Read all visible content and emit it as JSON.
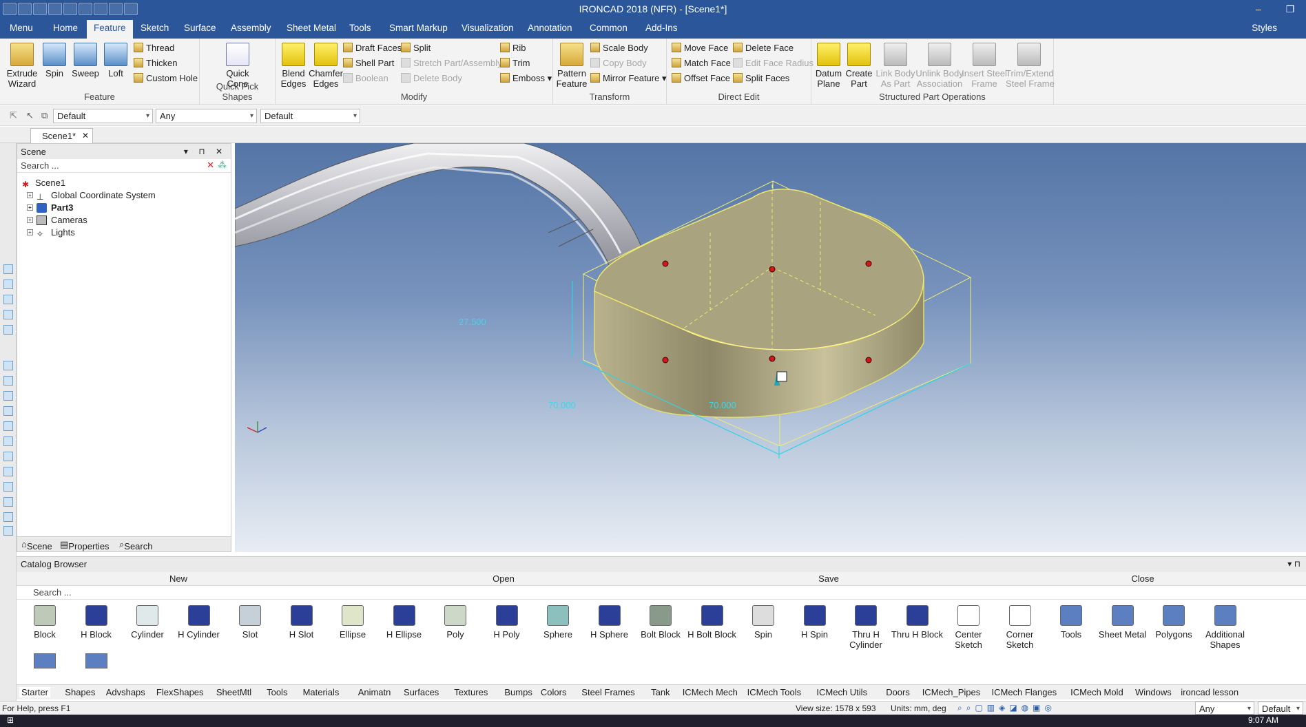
{
  "app": {
    "title": "IRONCAD 2018 (NFR) - [Scene1*]"
  },
  "menu": {
    "tabs": [
      "Menu",
      "Home",
      "Feature",
      "Sketch",
      "Surface",
      "Assembly",
      "Sheet Metal",
      "Tools",
      "Smart Markup",
      "Visualization",
      "Annotation",
      "Common",
      "Add-Ins"
    ],
    "active": "Feature",
    "styles": "Styles"
  },
  "ribbon": {
    "feature": {
      "extrude": "Extrude\nWizard",
      "spin": "Spin",
      "sweep": "Sweep",
      "loft": "Loft",
      "thread": "Thread",
      "thicken": "Thicken",
      "custom_hole": "Custom Hole",
      "label": "Feature"
    },
    "qps": {
      "quick_cone": "Quick\nCone",
      "label": "Quick Pick Shapes"
    },
    "modify": {
      "blend": "Blend\nEdges",
      "chamfer": "Chamfer\nEdges",
      "draft": "Draft Faces",
      "shell": "Shell Part",
      "boolean": "Boolean",
      "split": "Split",
      "stretch": "Stretch Part/Assembly",
      "delete_body": "Delete Body",
      "rib": "Rib",
      "trim": "Trim",
      "emboss": "Emboss",
      "label": "Modify"
    },
    "transform": {
      "pattern": "Pattern\nFeature",
      "scale": "Scale Body",
      "copy": "Copy Body",
      "mirror": "Mirror Feature",
      "label": "Transform"
    },
    "direct": {
      "move": "Move Face",
      "match": "Match Face",
      "offset": "Offset Face",
      "delete": "Delete Face",
      "edit_radius": "Edit Face Radius",
      "split": "Split Faces",
      "label": "Direct Edit"
    },
    "structured": {
      "datum": "Datum\nPlane",
      "create_part": "Create\nPart",
      "link": "Link Body\nAs Part",
      "unlink": "Unlink Body\nAssociation",
      "insert": "Insert Steel\nFrame",
      "trimext": "Trim/Extend\nSteel Frame",
      "label": "Structured Part Operations"
    }
  },
  "toolbar2": {
    "combo1": "Default",
    "combo2": "Any",
    "combo3": "Default"
  },
  "doc_tab": "Scene1*",
  "scene": {
    "title": "Scene",
    "search": "Search ...",
    "root": "Scene1",
    "items": [
      "Global Coordinate System",
      "Part3",
      "Cameras",
      "Lights"
    ],
    "tabs": [
      "Scene",
      "Properties",
      "Search"
    ]
  },
  "viewport": {
    "dim_height": "27.500",
    "dim_a": "70.000",
    "dim_b": "70.000"
  },
  "catalog": {
    "title": "Catalog Browser",
    "buttons": [
      "New",
      "Open",
      "Save",
      "Close"
    ],
    "search": "Search ...",
    "items": [
      "Block",
      "H Block",
      "Cylinder",
      "H Cylinder",
      "Slot",
      "H Slot",
      "Ellipse",
      "H Ellipse",
      "Poly",
      "H Poly",
      "Sphere",
      "H Sphere",
      "Bolt Block",
      "H Bolt Block",
      "Spin",
      "H Spin",
      "Thru H\nCylinder",
      "Thru H Block",
      "Center\nSketch",
      "Corner\nSketch",
      "Tools",
      "Sheet Metal",
      "Polygons",
      "Additional\nShapes"
    ],
    "tabs": [
      "Starter",
      "Shapes",
      "Advshaps",
      "FlexShapes",
      "SheetMtl",
      "Tools",
      "Materials",
      "Animatn",
      "Surfaces",
      "Textures",
      "Bumps",
      "Colors",
      "Steel Frames",
      "Tank",
      "ICMech Mech",
      "ICMech Tools",
      "ICMech Utils",
      "Doors",
      "ICMech_Pipes",
      "ICMech Flanges",
      "ICMech Mold",
      "Windows",
      "ironcad lesson"
    ]
  },
  "status": {
    "help": "For Help, press F1",
    "view": "View size: 1578 x  593",
    "units": "Units: mm, deg",
    "any": "Any",
    "default": "Default"
  },
  "taskbar": {
    "time": "9:07 AM"
  }
}
